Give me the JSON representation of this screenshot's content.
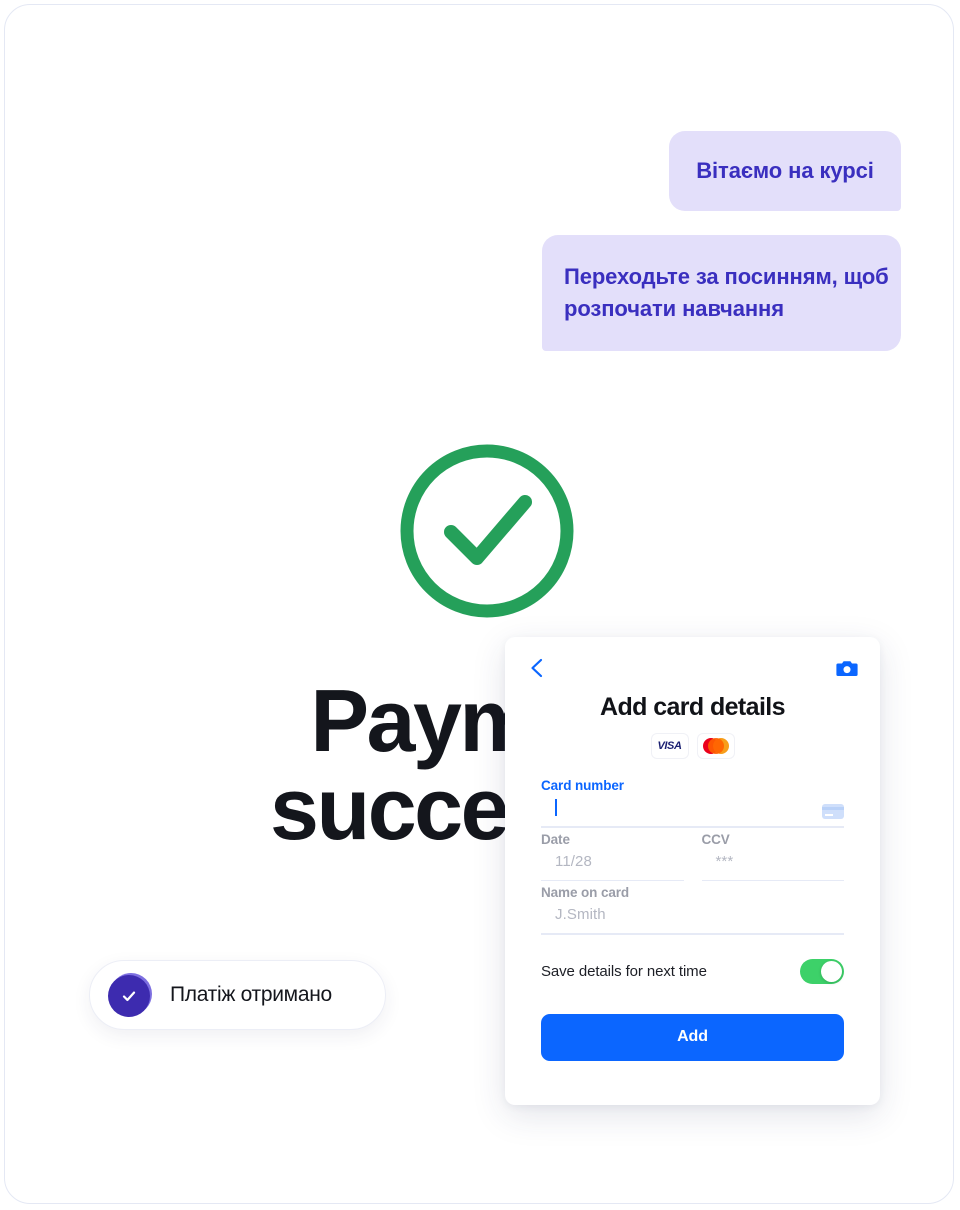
{
  "chat": {
    "messages": [
      {
        "text": "Вітаємо на курсі"
      },
      {
        "text": "Переходьте за посинням,\nщоб розпочати навчання"
      }
    ],
    "bubble_bg": "#E3DFFA",
    "bubble_text_color": "#3A2FBF"
  },
  "hero": {
    "status_icon": "check-circle-icon",
    "status_color": "#25A05A",
    "headline": "Payment\nsuccessful",
    "headline_color": "#14161C"
  },
  "payment_pill": {
    "icon": "check-badge-icon",
    "label": "Платіж отримано",
    "badge_color": "#3D2BAF",
    "ring_color": "#7D6FE0"
  },
  "card_panel": {
    "back_icon": "chevron-left-icon",
    "camera_icon": "camera-icon",
    "title": "Add card details",
    "brands": [
      {
        "name": "visa-logo",
        "label": "VISA"
      },
      {
        "name": "mastercard-logo",
        "label": ""
      }
    ],
    "fields": {
      "card_number": {
        "label": "Card number",
        "value": "",
        "placeholder": "",
        "active": true,
        "trailing_icon": "credit-card-icon"
      },
      "date": {
        "label": "Date",
        "value": "11/28"
      },
      "ccv": {
        "label": "CCV",
        "value": "***"
      },
      "name_on_card": {
        "label": "Name on card",
        "value": "J.Smith"
      }
    },
    "save_details": {
      "label": "Save details for next time",
      "enabled": true,
      "on_color": "#3DD169"
    },
    "submit": {
      "label": "Add",
      "color": "#0B66FF"
    }
  }
}
